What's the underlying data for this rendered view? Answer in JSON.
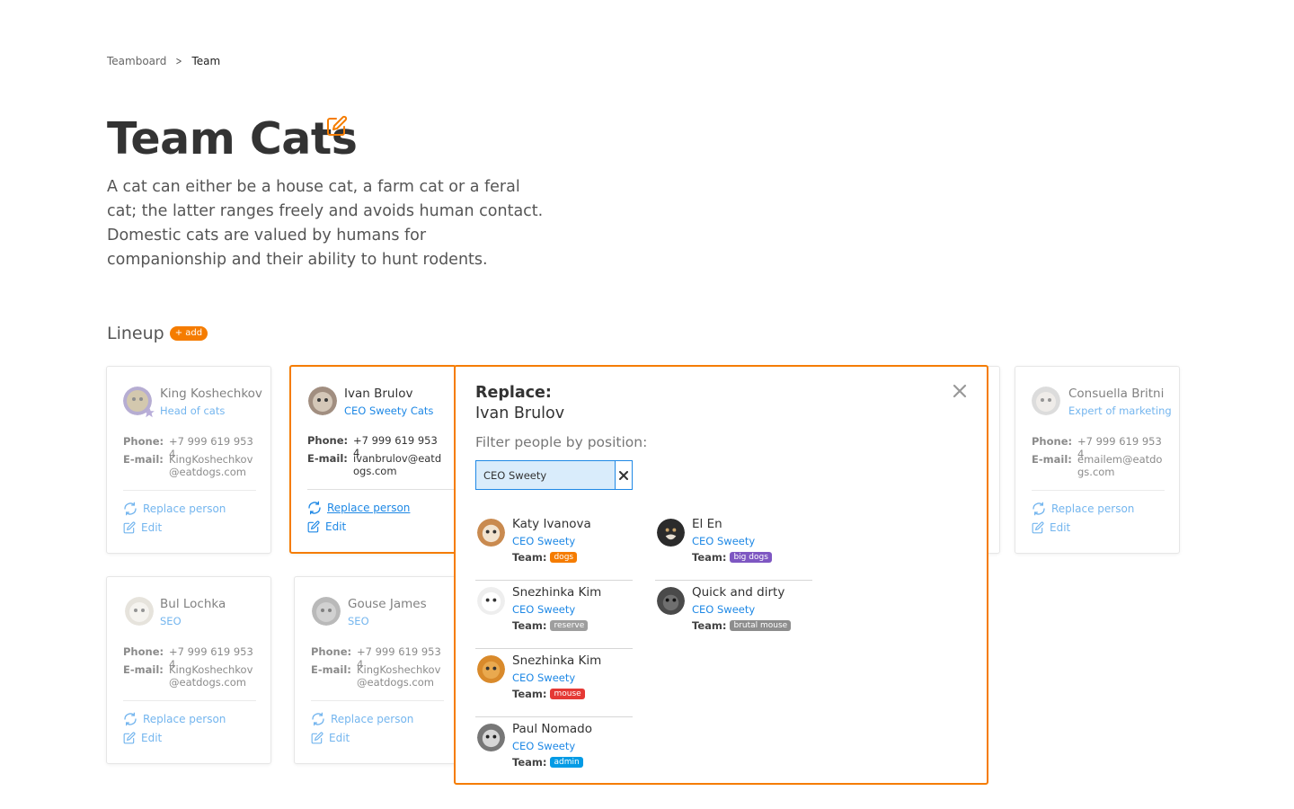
{
  "breadcrumb": {
    "parent": "Teamboard",
    "current": "Team"
  },
  "page": {
    "title": "Team Cats",
    "description": "A cat can either be a house cat, a farm cat or a feral cat; the latter ranges freely and avoids human contact. Domestic cats are valued by humans for companionship and their ability to hunt rodents."
  },
  "lineup": {
    "heading": "Lineup",
    "add_label": "+ add"
  },
  "labels": {
    "phone": "Phone:",
    "email": "E-mail:",
    "replace": "Replace person",
    "edit": "Edit"
  },
  "cards": [
    {
      "name": "King Koshechkov",
      "role": "Head of cats",
      "phone": "+7 999 619 9534",
      "email": "KingKoshechkov@eatdogs.com"
    },
    {
      "name": "Ivan Brulov",
      "role": "CEO Sweety Cats",
      "phone": "+7 999 619 9534",
      "email": "ivanbrulov@eatdogs.com"
    },
    {
      "name": "Consuella Britni",
      "role": "Expert of marketing",
      "phone": "+7 999 619 9534",
      "email": "emailem@eatdogs.com"
    },
    {
      "name": "Bul Lochka",
      "role": "SEO",
      "phone": "+7 999 619 9534",
      "email": "KingKoshechkov@eatdogs.com"
    },
    {
      "name": "Gouse James",
      "role": "SEO",
      "phone": "+7 999 619 9534",
      "email": "KingKoshechkov@eatdogs.com"
    }
  ],
  "popup": {
    "title": "Replace:",
    "person": "Ivan Brulov",
    "filter_label": "Filter people by position:",
    "filter_value": "CEO Sweety",
    "team_label": "Team:",
    "results": [
      {
        "name": "Katy Ivanova",
        "role": "CEO Sweety",
        "team": "dogs",
        "team_color": "#f57c00"
      },
      {
        "name": "Snezhinka Kim",
        "role": "CEO Sweety",
        "team": "reserve",
        "team_color": "#9e9e9e"
      },
      {
        "name": "Snezhinka Kim",
        "role": "CEO Sweety",
        "team": "mouse",
        "team_color": "#e53935"
      },
      {
        "name": "Paul Nomado",
        "role": "CEO Sweety",
        "team": "admin",
        "team_color": "#039be5"
      },
      {
        "name": "El En",
        "role": "CEO Sweety",
        "team": "big dogs",
        "team_color": "#7e57c2"
      },
      {
        "name": "Quick and dirty",
        "role": "CEO Sweety",
        "team": "brutal mouse",
        "team_color": "#8d8d8d"
      }
    ]
  },
  "colors": {
    "accent": "#f57c00",
    "link": "#1e88e5",
    "highlight": "#d9ecfb"
  }
}
